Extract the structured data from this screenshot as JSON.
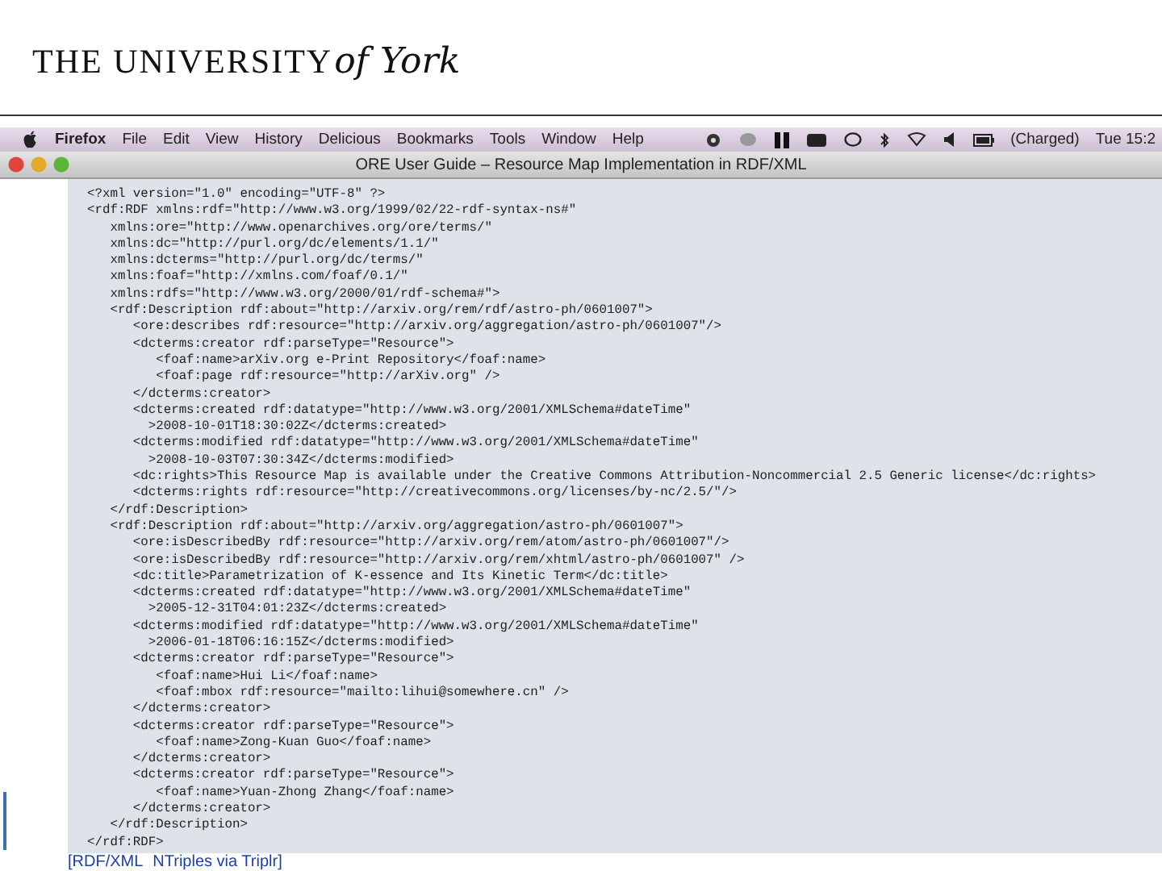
{
  "slide_header": {
    "logo_text": "THE UNIVERSITY",
    "logo_script": "of York"
  },
  "menubar": {
    "app": "Firefox",
    "items": [
      "File",
      "Edit",
      "View",
      "History",
      "Delicious",
      "Bookmarks",
      "Tools",
      "Window",
      "Help"
    ],
    "battery": "(Charged)",
    "clock": "Tue 15:2"
  },
  "window": {
    "title": "ORE User Guide – Resource Map Implementation in RDF/XML"
  },
  "code_lines": [
    "<?xml version=\"1.0\" encoding=\"UTF-8\" ?>",
    "<rdf:RDF xmlns:rdf=\"http://www.w3.org/1999/02/22-rdf-syntax-ns#\"",
    "   xmlns:ore=\"http://www.openarchives.org/ore/terms/\"",
    "   xmlns:dc=\"http://purl.org/dc/elements/1.1/\"",
    "   xmlns:dcterms=\"http://purl.org/dc/terms/\"",
    "   xmlns:foaf=\"http://xmlns.com/foaf/0.1/\"",
    "   xmlns:rdfs=\"http://www.w3.org/2000/01/rdf-schema#\">",
    "   <rdf:Description rdf:about=\"http://arxiv.org/rem/rdf/astro-ph/0601007\">",
    "      <ore:describes rdf:resource=\"http://arxiv.org/aggregation/astro-ph/0601007\"/>",
    "      <dcterms:creator rdf:parseType=\"Resource\">",
    "         <foaf:name>arXiv.org e-Print Repository</foaf:name>",
    "         <foaf:page rdf:resource=\"http://arXiv.org\" />",
    "      </dcterms:creator>",
    "      <dcterms:created rdf:datatype=\"http://www.w3.org/2001/XMLSchema#dateTime\"",
    "        >2008-10-01T18:30:02Z</dcterms:created>",
    "      <dcterms:modified rdf:datatype=\"http://www.w3.org/2001/XMLSchema#dateTime\"",
    "        >2008-10-03T07:30:34Z</dcterms:modified>",
    "      <dc:rights>This Resource Map is available under the Creative Commons Attribution-Noncommercial 2.5 Generic license</dc:rights>",
    "      <dcterms:rights rdf:resource=\"http://creativecommons.org/licenses/by-nc/2.5/\"/>",
    "   </rdf:Description>",
    "   <rdf:Description rdf:about=\"http://arxiv.org/aggregation/astro-ph/0601007\">",
    "      <ore:isDescribedBy rdf:resource=\"http://arxiv.org/rem/atom/astro-ph/0601007\"/>",
    "      <ore:isDescribedBy rdf:resource=\"http://arxiv.org/rem/xhtml/astro-ph/0601007\" />",
    "      <dc:title>Parametrization of K-essence and Its Kinetic Term</dc:title>",
    "      <dcterms:created rdf:datatype=\"http://www.w3.org/2001/XMLSchema#dateTime\"",
    "        >2005-12-31T04:01:23Z</dcterms:created>",
    "      <dcterms:modified rdf:datatype=\"http://www.w3.org/2001/XMLSchema#dateTime\"",
    "        >2006-01-18T06:16:15Z</dcterms:modified>",
    "      <dcterms:creator rdf:parseType=\"Resource\">",
    "         <foaf:name>Hui Li</foaf:name>",
    "         <foaf:mbox rdf:resource=\"mailto:lihui@somewhere.cn\" />",
    "      </dcterms:creator>",
    "      <dcterms:creator rdf:parseType=\"Resource\">",
    "         <foaf:name>Zong-Kuan Guo</foaf:name>",
    "      </dcterms:creator>",
    "      <dcterms:creator rdf:parseType=\"Resource\">",
    "         <foaf:name>Yuan-Zhong Zhang</foaf:name>",
    "      </dcterms:creator>",
    "   </rdf:Description>",
    "</rdf:RDF>"
  ],
  "footer_links": [
    "[RDF/XML",
    "NTriples via Triplr]"
  ]
}
